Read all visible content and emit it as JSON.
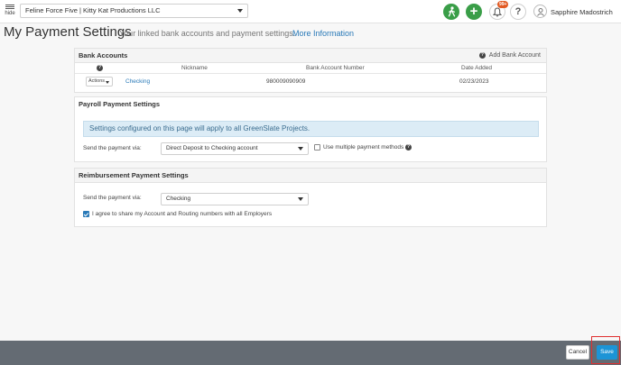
{
  "topbar": {
    "hide_label": "hide",
    "project_selector_value": "Feline Force Five | Kitty Kat Productions LLC",
    "add_icon": "+",
    "help_icon": "?",
    "notification_badge": "99+",
    "user_name": "Sapphire Madostrich",
    "accent_color": "#3a9e48"
  },
  "header": {
    "title": "My Payment Settings",
    "subtitle": "Your linked bank accounts and payment settings.",
    "more_info_link": "More Information"
  },
  "bank_accounts": {
    "heading": "Bank Accounts",
    "add_label": "Add Bank Account",
    "help_icon": "?",
    "columns": [
      "",
      "Nickname",
      "Bank Account Number",
      "Date Added"
    ],
    "rows": [
      {
        "actions": "Actions",
        "nickname": "Checking",
        "account_number": "980009090909",
        "date_added": "02/23/2023"
      }
    ]
  },
  "payroll": {
    "heading": "Payroll Payment Settings",
    "info_message": "Settings configured on this page will apply to all GreenSlate Projects.",
    "send_label": "Send the payment via:",
    "send_value": "Direct Deposit to Checking account",
    "multiple_methods_label": "Use multiple payment methods",
    "multiple_methods_checked": false,
    "help_icon": "?"
  },
  "reimbursement": {
    "heading": "Reimbursement Payment Settings",
    "send_label": "Send the payment via:",
    "send_value": "Checking",
    "agree_label": "I agree to share my Account and Routing numbers with all Employers",
    "agree_checked": true
  },
  "footer": {
    "cancel_label": "Cancel",
    "save_label": "Save",
    "save_color": "#1c94d6",
    "highlight_color": "#e03030"
  }
}
